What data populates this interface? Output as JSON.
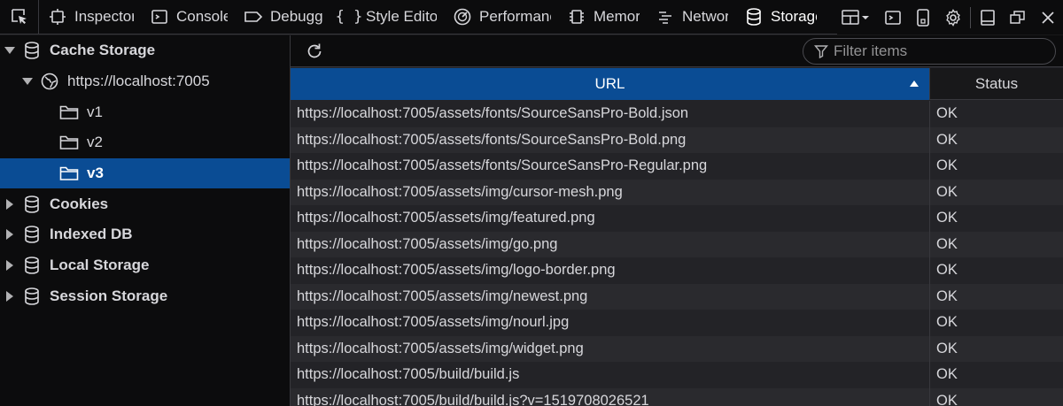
{
  "toolbar": {
    "tabs": [
      {
        "label": "Inspector",
        "icon": "inspector-icon"
      },
      {
        "label": "Console",
        "icon": "console-icon"
      },
      {
        "label": "Debugger",
        "icon": "debugger-icon"
      },
      {
        "label": "Style Editor",
        "icon": "style-editor-icon"
      },
      {
        "label": "Performance",
        "icon": "performance-icon"
      },
      {
        "label": "Memory",
        "icon": "memory-icon"
      },
      {
        "label": "Network",
        "icon": "network-icon"
      },
      {
        "label": "Storage",
        "icon": "storage-icon",
        "active": true
      }
    ]
  },
  "sidebar": {
    "cache_storage": "Cache Storage",
    "host": "https://localhost:7005",
    "caches": [
      "v1",
      "v2",
      "v3"
    ],
    "selected_cache": "v3",
    "cookies": "Cookies",
    "indexed_db": "Indexed DB",
    "local_storage": "Local Storage",
    "session_storage": "Session Storage"
  },
  "filter": {
    "placeholder": "Filter items"
  },
  "table": {
    "columns": {
      "url": "URL",
      "status": "Status"
    },
    "rows": [
      {
        "url": "https://localhost:7005/assets/fonts/SourceSansPro-Bold.json",
        "status": "OK"
      },
      {
        "url": "https://localhost:7005/assets/fonts/SourceSansPro-Bold.png",
        "status": "OK"
      },
      {
        "url": "https://localhost:7005/assets/fonts/SourceSansPro-Regular.png",
        "status": "OK"
      },
      {
        "url": "https://localhost:7005/assets/img/cursor-mesh.png",
        "status": "OK"
      },
      {
        "url": "https://localhost:7005/assets/img/featured.png",
        "status": "OK"
      },
      {
        "url": "https://localhost:7005/assets/img/go.png",
        "status": "OK"
      },
      {
        "url": "https://localhost:7005/assets/img/logo-border.png",
        "status": "OK"
      },
      {
        "url": "https://localhost:7005/assets/img/newest.png",
        "status": "OK"
      },
      {
        "url": "https://localhost:7005/assets/img/nourl.jpg",
        "status": "OK"
      },
      {
        "url": "https://localhost:7005/assets/img/widget.png",
        "status": "OK"
      },
      {
        "url": "https://localhost:7005/build/build.js",
        "status": "OK"
      },
      {
        "url": "https://localhost:7005/build/build.js?v=1519708026521",
        "status": "OK"
      }
    ]
  },
  "colors": {
    "selection": "#0a4c94",
    "background": "#18181a"
  }
}
